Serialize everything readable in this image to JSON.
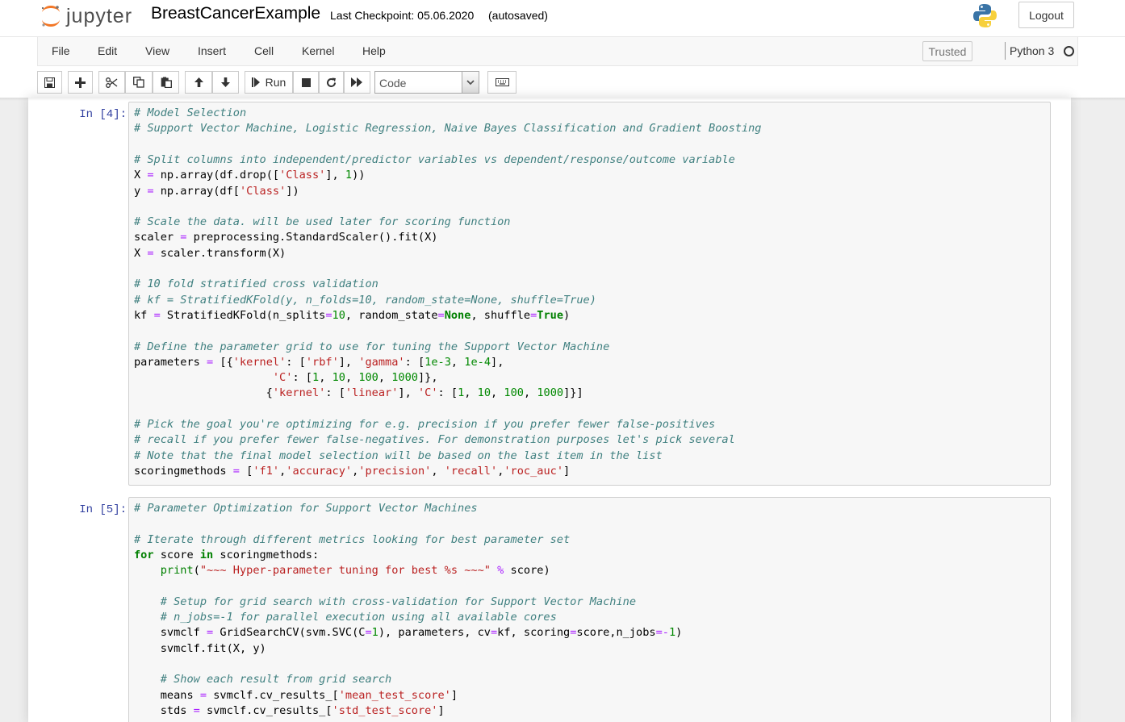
{
  "header": {
    "logo_text": "jupyter",
    "notebook_name": "BreastCancerExample",
    "checkpoint": "Last Checkpoint: 05.06.2020",
    "autosave": "(autosaved)",
    "logout_label": "Logout"
  },
  "menubar": {
    "items": [
      "File",
      "Edit",
      "View",
      "Insert",
      "Cell",
      "Kernel",
      "Help"
    ],
    "trusted_label": "Trusted",
    "kernel_name": "Python 3"
  },
  "toolbar": {
    "run_label": "Run",
    "cell_type": "Code"
  },
  "cells": [
    {
      "prompt": "In [4]:",
      "lines": [
        "# Model Selection",
        "# Support Vector Machine, Logistic Regression, Naive Bayes Classification and Gradient Boosting",
        "",
        "# Split columns into independent/predictor variables vs dependent/response/outcome variable",
        "X = np.array(df.drop(['Class'], 1))",
        "y = np.array(df['Class'])",
        "",
        "# Scale the data. will be used later for scoring function",
        "scaler = preprocessing.StandardScaler().fit(X)",
        "X = scaler.transform(X)",
        "",
        "# 10 fold stratified cross validation",
        "# kf = StratifiedKFold(y, n_folds=10, random_state=None, shuffle=True)",
        "kf = StratifiedKFold(n_splits=10, random_state=None, shuffle=True)",
        "",
        "# Define the parameter grid to use for tuning the Support Vector Machine",
        "parameters = [{'kernel': ['rbf'], 'gamma': [1e-3, 1e-4],",
        "                     'C': [1, 10, 100, 1000]},",
        "                    {'kernel': ['linear'], 'C': [1, 10, 100, 1000]}]",
        "",
        "# Pick the goal you're optimizing for e.g. precision if you prefer fewer false-positives",
        "# recall if you prefer fewer false-negatives. For demonstration purposes let's pick several",
        "# Note that the final model selection will be based on the last item in the list",
        "scoringmethods = ['f1','accuracy','precision', 'recall','roc_auc']"
      ]
    },
    {
      "prompt": "In [5]:",
      "lines": [
        "# Parameter Optimization for Support Vector Machines",
        "",
        "# Iterate through different metrics looking for best parameter set",
        "for score in scoringmethods:",
        "    print(\"~~~ Hyper-parameter tuning for best %s ~~~\" % score)",
        "",
        "    # Setup for grid search with cross-validation for Support Vector Machine",
        "    # n_jobs=-1 for parallel execution using all available cores",
        "    svmclf = GridSearchCV(svm.SVC(C=1), parameters, cv=kf, scoring=score,n_jobs=-1)",
        "    svmclf.fit(X, y)",
        "",
        "    # Show each result from grid search",
        "    means = svmclf.cv_results_['mean_test_score']",
        "    stds = svmclf.cv_results_['std_test_score']"
      ]
    }
  ]
}
